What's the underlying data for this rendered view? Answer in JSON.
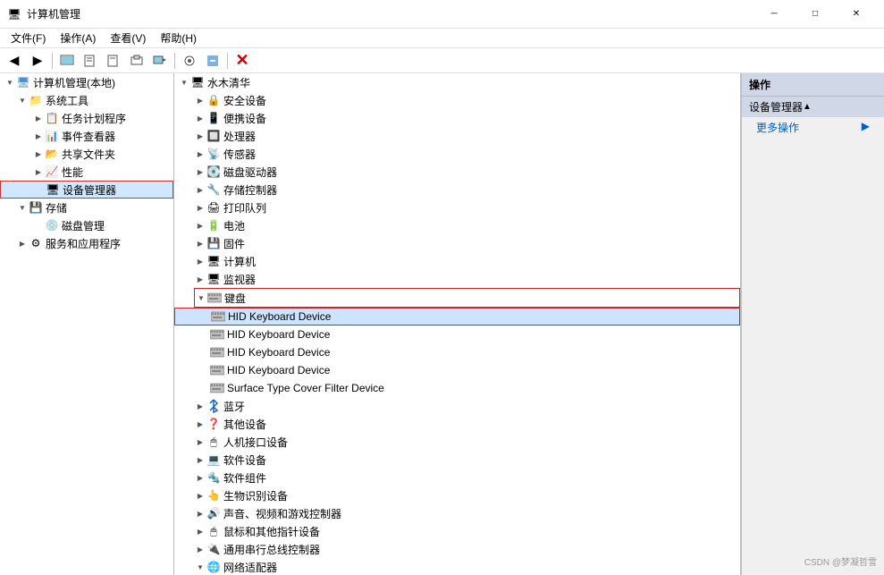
{
  "titleBar": {
    "icon": "🖥",
    "title": "计算机管理",
    "minimizeLabel": "─",
    "maximizeLabel": "□",
    "closeLabel": "✕"
  },
  "menuBar": {
    "items": [
      "文件(F)",
      "操作(A)",
      "查看(V)",
      "帮助(H)"
    ]
  },
  "toolbar": {
    "buttons": [
      "◀",
      "▶",
      "⬛",
      "⬛",
      "⬛",
      "⬛",
      "⬛",
      "⬛",
      "⬛",
      "✕"
    ]
  },
  "leftPanel": {
    "rootLabel": "计算机管理(本地)",
    "items": [
      {
        "label": "系统工具",
        "indent": 1,
        "expanded": true,
        "type": "folder"
      },
      {
        "label": "任务计划程序",
        "indent": 2,
        "type": "task"
      },
      {
        "label": "事件查看器",
        "indent": 2,
        "type": "event"
      },
      {
        "label": "共享文件夹",
        "indent": 2,
        "type": "share"
      },
      {
        "label": "性能",
        "indent": 2,
        "type": "perf"
      },
      {
        "label": "设备管理器",
        "indent": 2,
        "type": "devmgr",
        "selected": true
      },
      {
        "label": "存储",
        "indent": 1,
        "type": "folder"
      },
      {
        "label": "磁盘管理",
        "indent": 2,
        "type": "disk"
      },
      {
        "label": "服务和应用程序",
        "indent": 1,
        "type": "service"
      }
    ]
  },
  "centerPanel": {
    "rootLabel": "水木清华",
    "categories": [
      {
        "label": "安全设备",
        "indent": 1
      },
      {
        "label": "便携设备",
        "indent": 1
      },
      {
        "label": "处理器",
        "indent": 1
      },
      {
        "label": "传感器",
        "indent": 1
      },
      {
        "label": "磁盘驱动器",
        "indent": 1
      },
      {
        "label": "存储控制器",
        "indent": 1
      },
      {
        "label": "打印队列",
        "indent": 1
      },
      {
        "label": "电池",
        "indent": 1
      },
      {
        "label": "固件",
        "indent": 1
      },
      {
        "label": "计算机",
        "indent": 1
      },
      {
        "label": "监视器",
        "indent": 1
      },
      {
        "label": "键盘",
        "indent": 1,
        "expanded": true
      },
      {
        "label": "HID Keyboard Device",
        "indent": 2,
        "selected": true
      },
      {
        "label": "HID Keyboard Device",
        "indent": 2
      },
      {
        "label": "HID Keyboard Device",
        "indent": 2
      },
      {
        "label": "HID Keyboard Device",
        "indent": 2
      },
      {
        "label": "Surface Type Cover Filter Device",
        "indent": 2
      },
      {
        "label": "蓝牙",
        "indent": 1
      },
      {
        "label": "其他设备",
        "indent": 1
      },
      {
        "label": "人机接口设备",
        "indent": 1
      },
      {
        "label": "软件设备",
        "indent": 1
      },
      {
        "label": "软件组件",
        "indent": 1
      },
      {
        "label": "生物识别设备",
        "indent": 1
      },
      {
        "label": "声音、视频和游戏控制器",
        "indent": 1
      },
      {
        "label": "鼠标和其他指针设备",
        "indent": 1
      },
      {
        "label": "通用串行总线控制器",
        "indent": 1
      },
      {
        "label": "网络适配器",
        "indent": 1,
        "collapsed": true
      }
    ]
  },
  "rightPanel": {
    "title": "操作",
    "sectionTitle": "设备管理器",
    "items": [
      {
        "label": "更多操作",
        "hasArrow": true
      }
    ]
  },
  "watermark": "CSDN @梦凝哲雪"
}
